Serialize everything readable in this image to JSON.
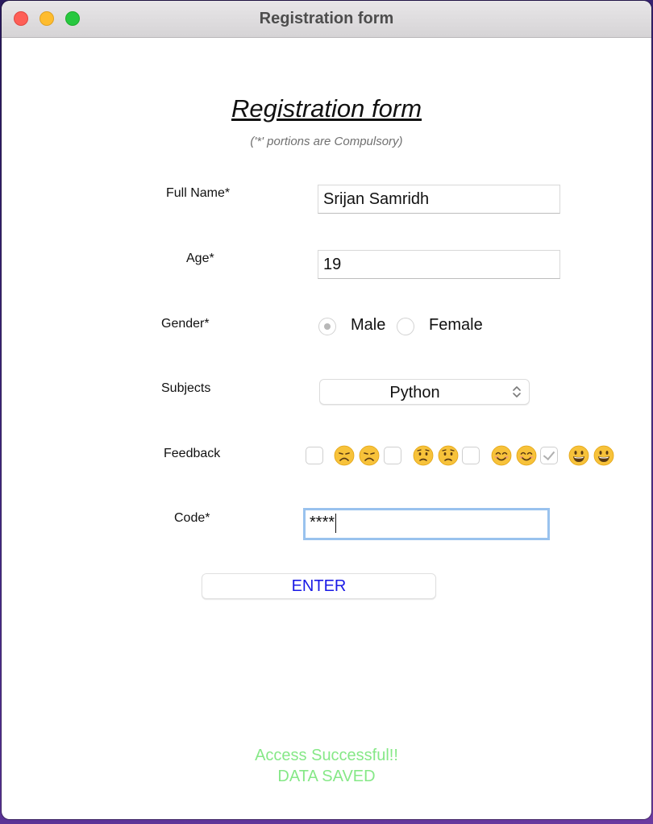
{
  "window": {
    "title": "Registration form"
  },
  "form": {
    "title": "Registration form",
    "subtitle": "('*' portions are Compulsory)"
  },
  "fields": {
    "full_name": {
      "label": "Full Name*",
      "value": "Srijan Samridh"
    },
    "age": {
      "label": "Age*",
      "value": "19"
    },
    "gender": {
      "label": "Gender*",
      "options": [
        "Male",
        "Female"
      ],
      "selected": "Male"
    },
    "subjects": {
      "label": "Subjects",
      "selected": "Python"
    },
    "feedback": {
      "label": "Feedback",
      "items": [
        {
          "icon": "disappointed-face-icon",
          "checked": false
        },
        {
          "icon": "worried-face-icon",
          "checked": false
        },
        {
          "icon": "smiling-face-icon",
          "checked": false
        },
        {
          "icon": "grinning-face-icon",
          "checked": true
        }
      ]
    },
    "code": {
      "label": "Code*",
      "value": "****"
    }
  },
  "actions": {
    "enter_label": "ENTER"
  },
  "status": {
    "line1": "Access Successful!!",
    "line2": "DATA SAVED",
    "color": "#86e887"
  },
  "colors": {
    "button_text": "#1a1ae6",
    "focus_ring": "#99c2ee"
  }
}
